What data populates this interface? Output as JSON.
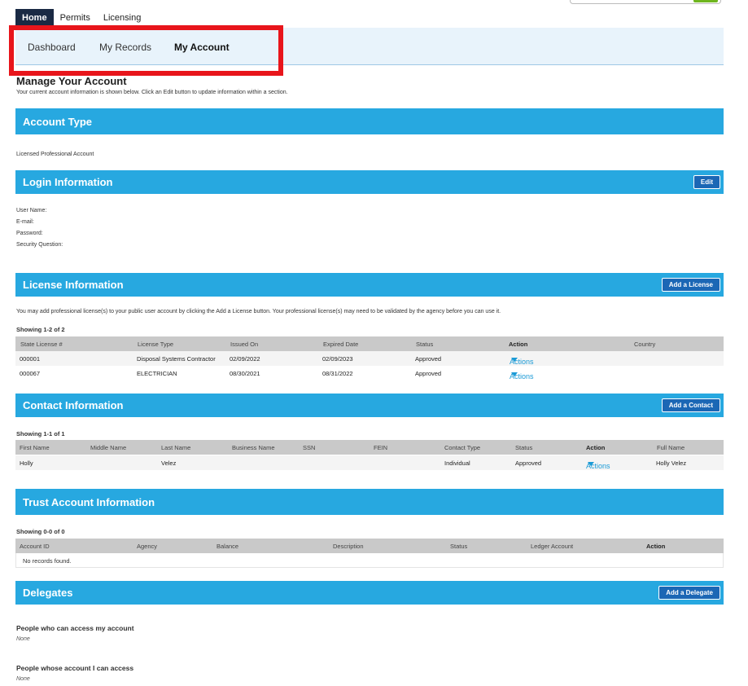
{
  "topnav": {
    "tabs": [
      "Home",
      "Permits",
      "Licensing"
    ]
  },
  "subnav": {
    "tabs": [
      "Dashboard",
      "My Records",
      "My Account"
    ]
  },
  "page": {
    "title": "Manage Your Account",
    "subtitle": "Your current account information is shown below. Click an Edit button to update information within a section."
  },
  "account_type": {
    "header": "Account Type",
    "value": "Licensed Professional Account"
  },
  "login": {
    "header": "Login Information",
    "edit_label": "Edit",
    "fields": [
      {
        "label": "User Name:",
        "value": ""
      },
      {
        "label": "E-mail:",
        "value": ""
      },
      {
        "label": "Password:",
        "value": ""
      },
      {
        "label": "Security Question:",
        "value": ""
      }
    ]
  },
  "license": {
    "header": "License Information",
    "add_label": "Add a License",
    "note": "You may add professional license(s) to your public user account by clicking the Add a License button. Your professional license(s) may need to be validated by the agency before you can use it.",
    "showing": "Showing 1-2 of 2",
    "columns": [
      "State License #",
      "License Type",
      "Issued On",
      "Expired Date",
      "Status",
      "Action",
      "Country"
    ],
    "rows": [
      {
        "number": "000001",
        "type": "Disposal Systems Contractor",
        "issued": "02/09/2022",
        "expired": "02/09/2023",
        "status": "Approved",
        "action": "Actions",
        "country": ""
      },
      {
        "number": "000067",
        "type": "ELECTRICIAN",
        "issued": "08/30/2021",
        "expired": "08/31/2022",
        "status": "Approved",
        "action": "Actions",
        "country": ""
      }
    ]
  },
  "contact": {
    "header": "Contact Information",
    "add_label": "Add a Contact",
    "showing": "Showing 1-1 of 1",
    "columns": [
      "First Name",
      "Middle Name",
      "Last Name",
      "Business Name",
      "SSN",
      "FEIN",
      "Contact Type",
      "Status",
      "Action",
      "Full Name"
    ],
    "rows": [
      {
        "first": "Holly",
        "middle": "",
        "last": "Velez",
        "business": "",
        "ssn": "",
        "fein": "",
        "type": "Individual",
        "status": "Approved",
        "action": "Actions",
        "full": "Holly Velez"
      }
    ]
  },
  "trust": {
    "header": "Trust Account Information",
    "showing": "Showing 0-0 of 0",
    "columns": [
      "Account ID",
      "Agency",
      "Balance",
      "Description",
      "Status",
      "Ledger Account",
      "Action"
    ],
    "empty": "No records found."
  },
  "delegates": {
    "header": "Delegates",
    "add_label": "Add a Delegate",
    "can_access_label": "People who can access my account",
    "can_access_value": "None",
    "i_access_label": "People whose account I can access",
    "i_access_value": "None"
  },
  "colors": {
    "section_bar": "#27a8e0",
    "button": "#1b67b5",
    "highlight": "#e8151b",
    "link": "#1a9ad6"
  }
}
